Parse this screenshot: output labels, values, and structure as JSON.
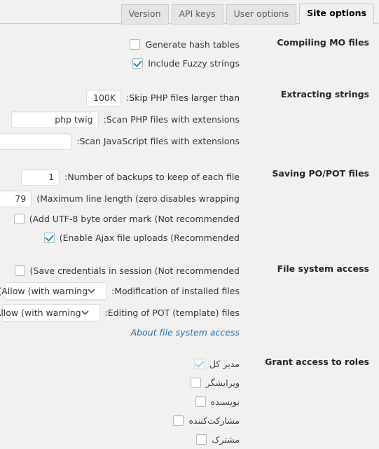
{
  "tabs": [
    {
      "label": "Version",
      "active": false
    },
    {
      "label": "API keys",
      "active": false
    },
    {
      "label": "User options",
      "active": false
    },
    {
      "label": "Site options",
      "active": true
    }
  ],
  "sections": {
    "compiling": {
      "heading": "Compiling MO files",
      "generate_hash_tables_label": "Generate hash tables",
      "generate_hash_tables_checked": false,
      "include_fuzzy_label": "Include Fuzzy strings",
      "include_fuzzy_checked": true
    },
    "extracting": {
      "heading": "Extracting strings",
      "skip_php_label": ":Skip PHP files larger than",
      "skip_php_value": "100K",
      "scan_php_label": ":Scan PHP files with extensions",
      "scan_php_value": "php twig",
      "scan_js_label": ":Scan JavaScript files with extensions",
      "scan_js_value": ""
    },
    "saving": {
      "heading": "Saving PO/POT files",
      "backups_label": ":Number of backups to keep of each file",
      "backups_value": "1",
      "linelength_label": "(Maximum line length (zero disables wrapping",
      "linelength_value": "79",
      "bom_label": "(Add UTF-8 byte order mark (Not recommended",
      "bom_checked": false,
      "ajax_label": "(Enable Ajax file uploads (Recommended",
      "ajax_checked": true
    },
    "filesystem": {
      "heading": "File system access",
      "credentials_label": "(Save credentials in session (Not recommended",
      "credentials_checked": false,
      "modification_label": ":Modification of installed files",
      "modification_value": "(Allow (with warning",
      "editing_label": ":Editing of POT (template) files",
      "editing_value": "(Allow (with warning",
      "about_link": "About file system access"
    },
    "roles": {
      "heading": "Grant access to roles",
      "items": [
        {
          "label": "مدیر کل",
          "checked": true,
          "disabled": true
        },
        {
          "label": "ویرایشگر",
          "checked": false,
          "disabled": false
        },
        {
          "label": "نویسنده",
          "checked": false,
          "disabled": false
        },
        {
          "label": "مشارکت‌کننده",
          "checked": false,
          "disabled": false
        },
        {
          "label": "مشترک",
          "checked": false,
          "disabled": false
        }
      ]
    }
  },
  "icons": {
    "chevron_down": "chevron-down-icon",
    "checkmark": "checkmark-icon"
  },
  "colors": {
    "background": "#f1f1f1",
    "accent_check": "#1e8cbe",
    "link": "#2271b1",
    "heading": "#23282d",
    "border": "#dddddd"
  }
}
